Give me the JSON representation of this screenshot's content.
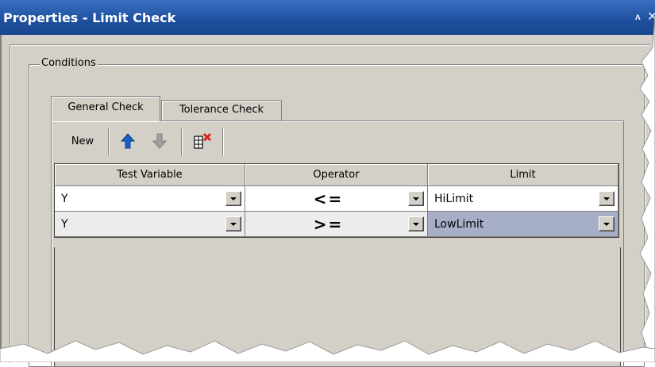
{
  "window": {
    "title": "Properties - Limit Check",
    "pin_glyph": "ᴧ",
    "close_glyph": "✕"
  },
  "group": {
    "label": "Conditions"
  },
  "tabs": [
    {
      "label": "General Check",
      "active": true
    },
    {
      "label": "Tolerance Check",
      "active": false
    }
  ],
  "toolbar": {
    "new_label": "New",
    "icons": [
      "move-up-icon",
      "move-down-icon",
      "delete-row-icon"
    ]
  },
  "grid": {
    "columns": [
      "Test Variable",
      "Operator",
      "Limit"
    ],
    "rows": [
      {
        "test_variable": "Y",
        "operator": "<=",
        "limit": "HiLimit"
      },
      {
        "test_variable": "Y",
        "operator": ">=",
        "limit": "LowLimit"
      }
    ]
  },
  "colors": {
    "title_bar": "#1d4f9e",
    "face": "#d4d0c8",
    "selected_cell": "#a7aec8",
    "up_arrow": "#1a5fc8",
    "down_arrow": "#a0a0a0",
    "delete_x": "#e02020"
  }
}
